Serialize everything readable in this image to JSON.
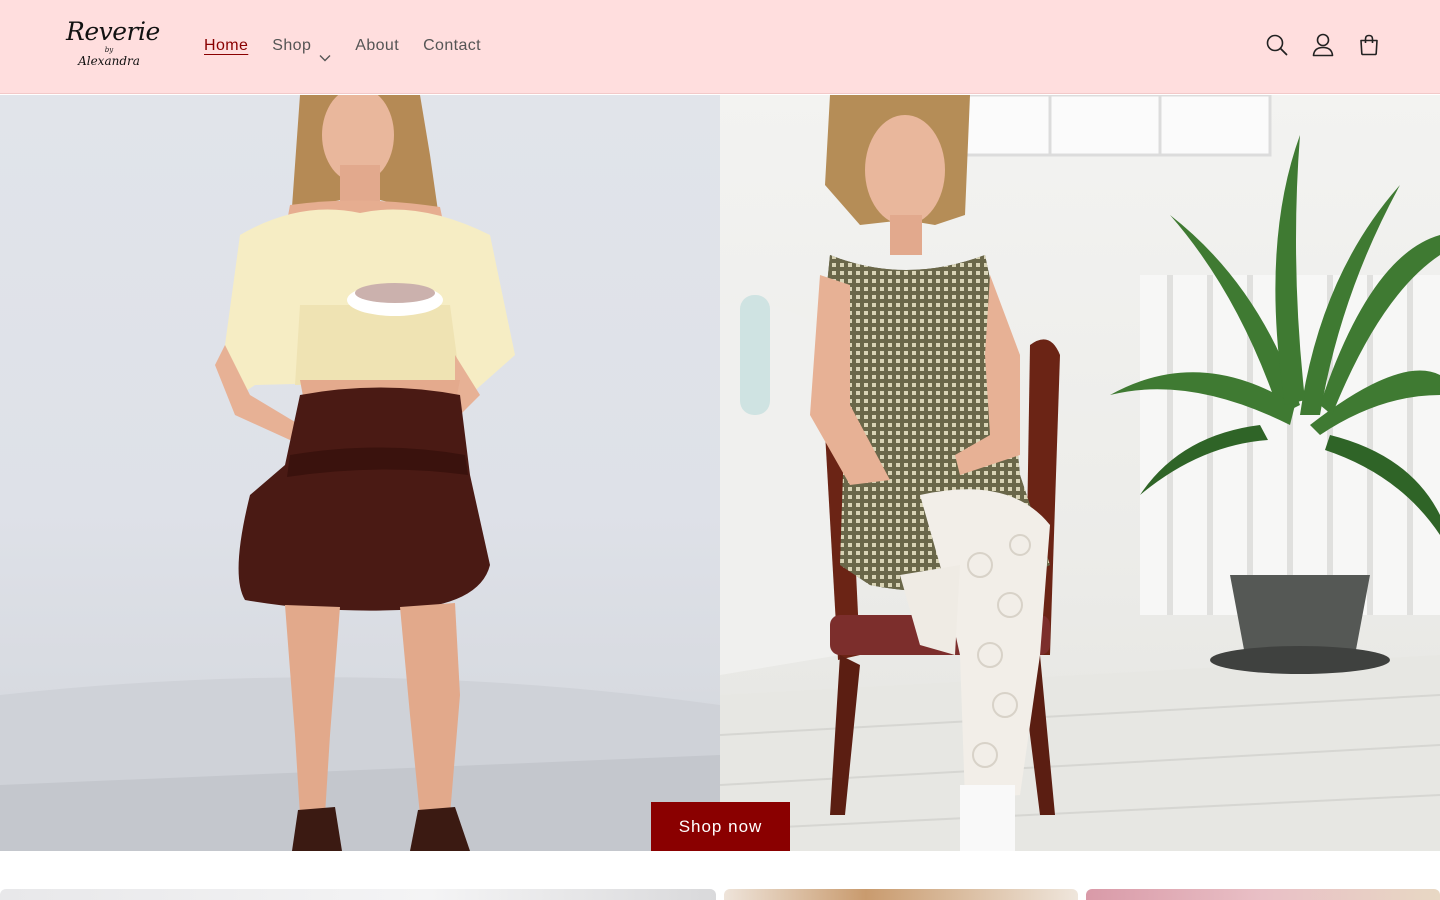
{
  "brand": {
    "logo_main": "Reverie",
    "logo_by": "by",
    "logo_sub": "Alexandra"
  },
  "nav": {
    "items": [
      {
        "label": "Home",
        "active": true
      },
      {
        "label": "Shop",
        "has_dropdown": true
      },
      {
        "label": "About"
      },
      {
        "label": "Contact"
      }
    ]
  },
  "header_icons": [
    "search-icon",
    "account-icon",
    "cart-icon"
  ],
  "hero": {
    "cta_label": "Shop now"
  },
  "colors": {
    "header_bg": "#ffdede",
    "accent": "#8a0000",
    "nav_text": "#555555"
  }
}
